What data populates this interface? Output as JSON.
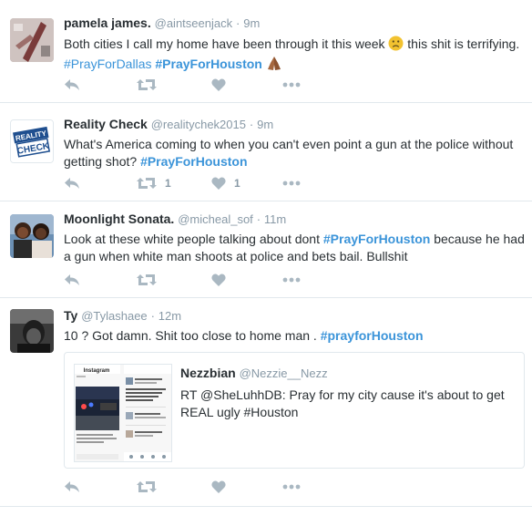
{
  "tweets": [
    {
      "name": "pamela james.",
      "handle": "@aintseenjack",
      "sep": "·",
      "time": "9m",
      "text_a": "Both cities I call my home have been through it this week ",
      "text_b": " this shit is terrifying.  ",
      "tag1": "#PrayForDallas",
      "space": " ",
      "tag2": "#PrayForHouston",
      "emoji1": "frown-face",
      "emoji2": "praying-hands"
    },
    {
      "name": "Reality Check",
      "handle": "@realitychek2015",
      "sep": "·",
      "time": "9m",
      "avatar_line1": "REALITY",
      "avatar_line2": "CHECK",
      "text": "What's America coming to when you can't even point a gun at the police without getting shot? ",
      "tag": "#PrayForHouston",
      "retweets": "1",
      "likes": "1"
    },
    {
      "name": "Moonlight Sonata.",
      "handle": "@micheal_sof",
      "sep": "·",
      "time": "11m",
      "text_a": "Look at these white people talking about dont ",
      "tag": "#PrayForHouston",
      "text_b": " because he had a gun when white man shoots at police and bets bail. Bullshit"
    },
    {
      "name": "Ty",
      "handle": "@Tylashaee",
      "sep": "·",
      "time": "12m",
      "text": "10 ? Got damn. Shit too close to home man . ",
      "tag": "#prayforHouston",
      "quote": {
        "name": "Nezzbian",
        "handle": "@Nezzie__Nezz",
        "text": "RT @SheLuhhDB: Pray for my city cause it's about to get REAL ugly #Houston",
        "thumb_app": "Instagram"
      }
    }
  ],
  "icons": {
    "reply": "reply-icon",
    "retweet": "retweet-icon",
    "like": "heart-icon",
    "more": "more-icon"
  },
  "colors": {
    "accent": "#3b94d9",
    "muted": "#8899a6",
    "icon": "#aab8c2",
    "border": "#e1e8ed"
  }
}
